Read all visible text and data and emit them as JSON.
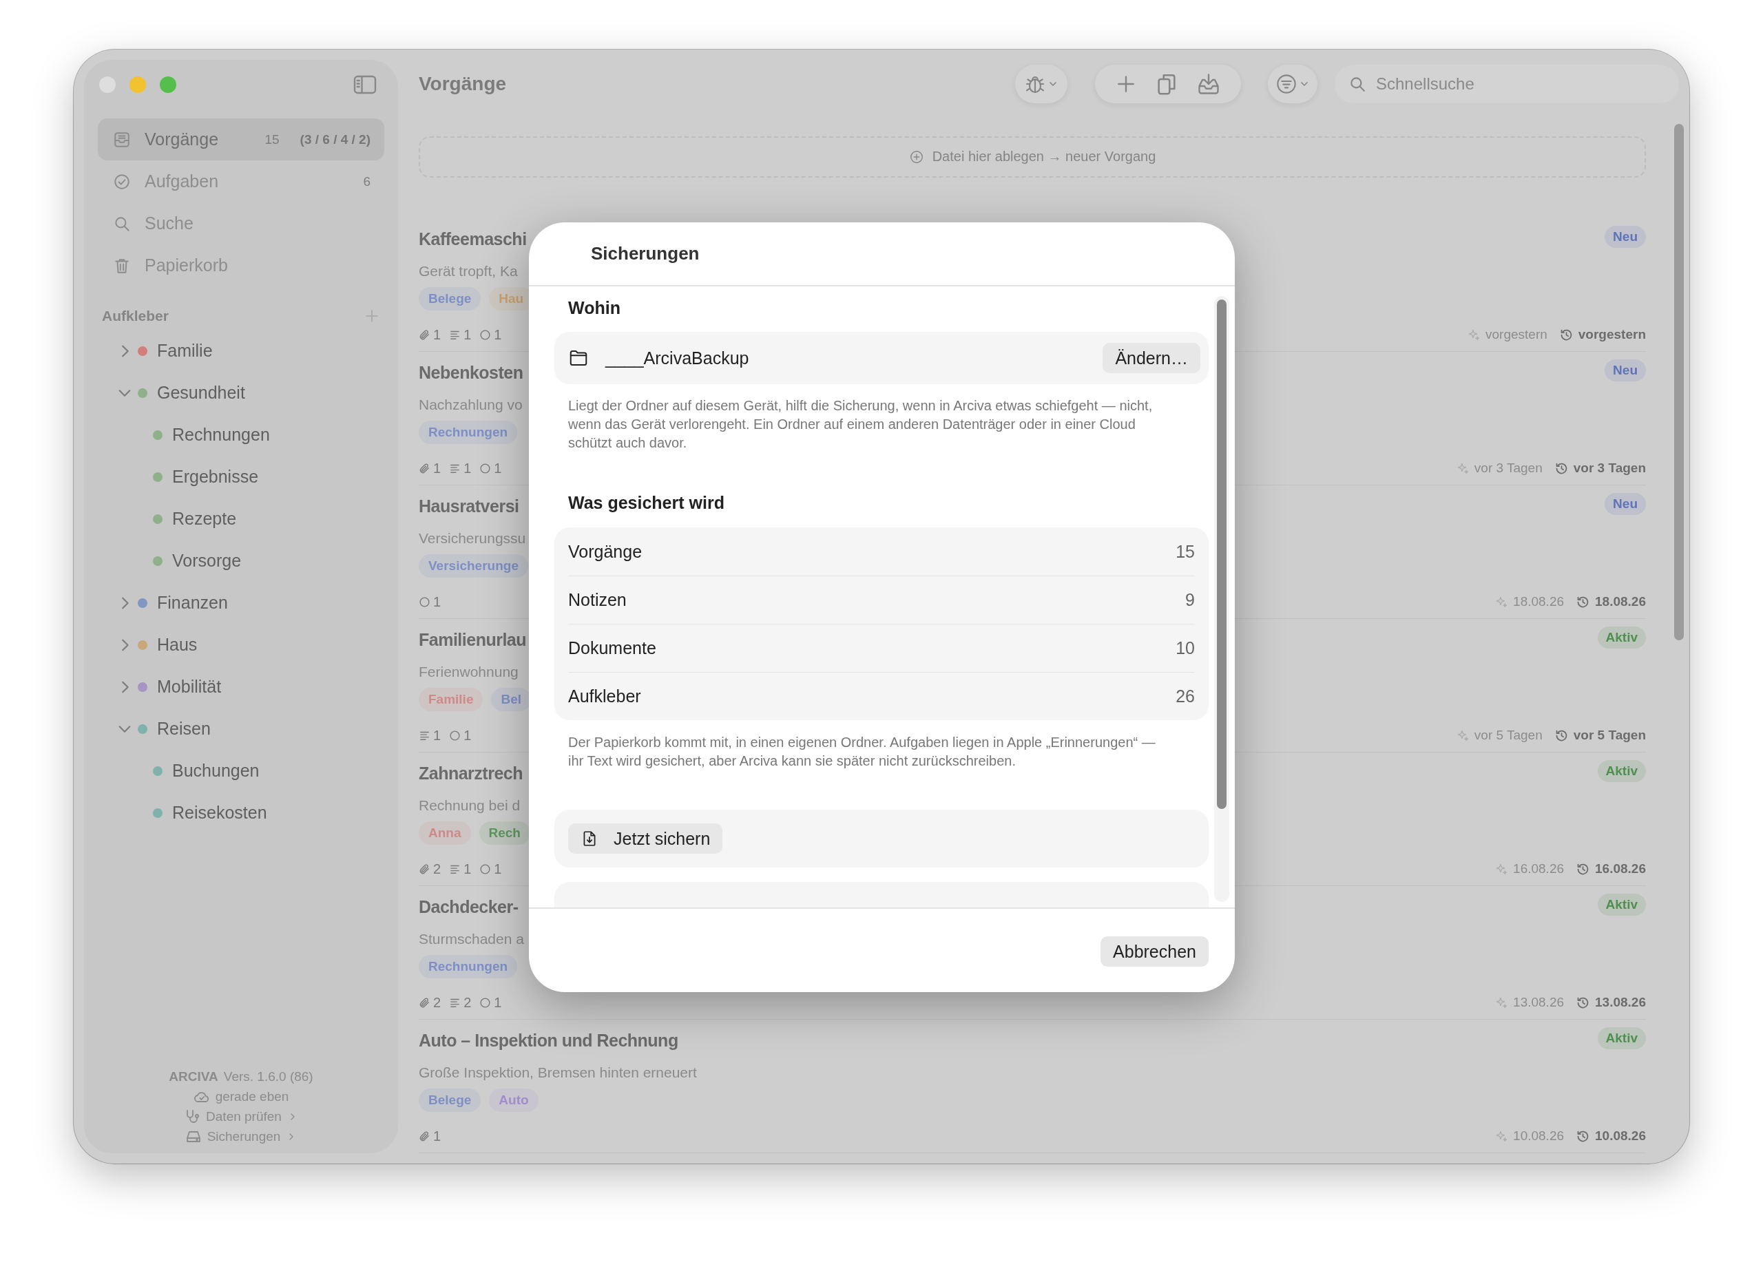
{
  "sidebar": {
    "nav": [
      {
        "label": "Vorgänge",
        "count": "15",
        "breakdown": "(3 / 6 / 4 / 2)",
        "selected": true
      },
      {
        "label": "Aufgaben",
        "count": "6",
        "selected": false
      },
      {
        "label": "Suche",
        "selected": false
      },
      {
        "label": "Papierkorb",
        "selected": false
      }
    ],
    "labels_heading": "Aufkleber",
    "labels": [
      {
        "label": "Familie",
        "color": "#d07f79",
        "expanded": false
      },
      {
        "label": "Gesundheit",
        "color": "#8fb08a",
        "expanded": true,
        "children": [
          {
            "label": "Rechnungen",
            "color": "#8fb08a"
          },
          {
            "label": "Ergebnisse",
            "color": "#8fb08a"
          },
          {
            "label": "Rezepte",
            "color": "#8fb08a"
          },
          {
            "label": "Vorsorge",
            "color": "#8fb08a"
          }
        ]
      },
      {
        "label": "Finanzen",
        "color": "#8196c2",
        "expanded": false
      },
      {
        "label": "Haus",
        "color": "#c9a77a",
        "expanded": false
      },
      {
        "label": "Mobilität",
        "color": "#a594c4",
        "expanded": false
      },
      {
        "label": "Reisen",
        "color": "#7fb2ac",
        "expanded": true,
        "children": [
          {
            "label": "Buchungen",
            "color": "#7fb2ac"
          },
          {
            "label": "Reisekosten",
            "color": "#7fb2ac"
          }
        ]
      }
    ],
    "footer": {
      "app": "ARCIVA",
      "version": "Vers. 1.6.0 (86)",
      "sync": "gerade eben",
      "links": [
        "Daten prüfen",
        "Sicherungen"
      ]
    }
  },
  "toolbar": {
    "title": "Vorgänge",
    "search": {
      "placeholder": "Schnellsuche"
    }
  },
  "dropzone": "Datei hier ablegen → neuer Vorgang",
  "items": [
    {
      "title": "Kaffeemaschi",
      "description": "Gerät tropft, Ka",
      "tags": [
        {
          "label": "Belege",
          "color": "#7d8fc4"
        },
        {
          "label": "Hau",
          "color": "#c9a36f"
        }
      ],
      "meta": [
        {
          "kind": "attachments",
          "count": "1"
        },
        {
          "kind": "notes",
          "count": "1"
        },
        {
          "kind": "tasks",
          "count": "1"
        }
      ],
      "status": {
        "label": "Neu",
        "color": "#5f74b8"
      },
      "created": "vorgestern",
      "modified": "vorgestern"
    },
    {
      "title": "Nebenkosten",
      "description": "Nachzahlung vo",
      "tags": [
        {
          "label": "Rechnungen",
          "color": "#7d8fc4"
        }
      ],
      "meta": [
        {
          "kind": "attachments",
          "count": "1"
        },
        {
          "kind": "notes",
          "count": "1"
        },
        {
          "kind": "tasks",
          "count": "1"
        }
      ],
      "status": {
        "label": "Neu",
        "color": "#5f74b8"
      },
      "created": "vor 3 Tagen",
      "modified": "vor 3 Tagen"
    },
    {
      "title": "Hausratversi",
      "description": "Versicherungssu",
      "tags": [
        {
          "label": "Versicherunge",
          "color": "#7d8fc4"
        }
      ],
      "meta": [
        {
          "kind": "tasks",
          "count": "1"
        }
      ],
      "status": {
        "label": "Neu",
        "color": "#5f74b8"
      },
      "created": "18.08.26",
      "modified": "18.08.26"
    },
    {
      "title": "Familienurlau",
      "description": "Ferienwohnung",
      "tags": [
        {
          "label": "Familie",
          "color": "#cf8a88"
        },
        {
          "label": "Bel",
          "color": "#7d8fc4"
        }
      ],
      "meta": [
        {
          "kind": "notes",
          "count": "1"
        },
        {
          "kind": "tasks",
          "count": "1"
        }
      ],
      "status": {
        "label": "Aktiv",
        "color": "#4f8f4f"
      },
      "created": "vor 5 Tagen",
      "modified": "vor 5 Tagen"
    },
    {
      "title": "Zahnarztrech",
      "description": "Rechnung bei d",
      "tags": [
        {
          "label": "Anna",
          "color": "#cf8a88"
        },
        {
          "label": "Rech",
          "color": "#5c985c"
        }
      ],
      "meta": [
        {
          "kind": "attachments",
          "count": "2"
        },
        {
          "kind": "notes",
          "count": "1"
        },
        {
          "kind": "tasks",
          "count": "1"
        }
      ],
      "status": {
        "label": "Aktiv",
        "color": "#4f8f4f"
      },
      "created": "16.08.26",
      "modified": "16.08.26"
    },
    {
      "title": "Dachdecker-",
      "description": "Sturmschaden a",
      "tags": [
        {
          "label": "Rechnungen",
          "color": "#7d8fc4"
        }
      ],
      "meta": [
        {
          "kind": "attachments",
          "count": "2"
        },
        {
          "kind": "notes",
          "count": "2"
        },
        {
          "kind": "tasks",
          "count": "1"
        }
      ],
      "status": {
        "label": "Aktiv",
        "color": "#4f8f4f"
      },
      "created": "13.08.26",
      "modified": "13.08.26"
    },
    {
      "title": "Auto – Inspektion und Rechnung",
      "description": "Große Inspektion, Bremsen hinten erneuert",
      "tags": [
        {
          "label": "Belege",
          "color": "#7d8fc4"
        },
        {
          "label": "Auto",
          "color": "#a28ccb"
        }
      ],
      "meta": [
        {
          "kind": "attachments",
          "count": "1"
        }
      ],
      "status": {
        "label": "Aktiv",
        "color": "#4f8f4f"
      },
      "created": "10.08.26",
      "modified": "10.08.26"
    }
  ],
  "dialog": {
    "title": "Sicherungen",
    "destination_heading": "Wohin",
    "folder": "____ArcivaBackup",
    "change_button": "Ändern…",
    "destination_note": "Liegt der Ordner auf diesem Gerät, hilft die Sicherung, wenn in Arciva etwas schiefgeht — nicht, wenn das Gerät verlorengeht. Ein Ordner auf einem anderen Datenträger oder in einer Cloud schützt auch davor.",
    "contents_heading": "Was gesichert wird",
    "contents": [
      {
        "label": "Vorgänge",
        "count": "15"
      },
      {
        "label": "Notizen",
        "count": "9"
      },
      {
        "label": "Dokumente",
        "count": "10"
      },
      {
        "label": "Aufkleber",
        "count": "26"
      }
    ],
    "contents_note": "Der Papierkorb kommt mit, in einen eigenen Ordner. Aufgaben liegen in Apple „Erinnerungen“ — ihr Text wird gesichert, aber Arciva kann sie später nicht zurückschreiben.",
    "backup_button": "Jetzt sichern",
    "cancel_button": "Abbrechen"
  }
}
